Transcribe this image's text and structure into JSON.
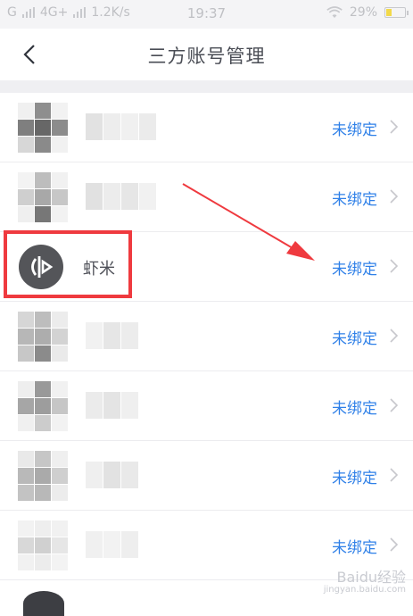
{
  "status_bar": {
    "signal_left": "G",
    "network": "4G+",
    "speed": "1.2K/s",
    "time": "19:37",
    "battery_percent": "29%",
    "battery_level": 0.29,
    "battery_color": "#f2d94a"
  },
  "header": {
    "title": "三方账号管理"
  },
  "rows": [
    {
      "name": "",
      "status": "未绑定"
    },
    {
      "name": "",
      "status": "未绑定"
    },
    {
      "name": "虾米",
      "status": "未绑定"
    },
    {
      "name": "",
      "status": "未绑定"
    },
    {
      "name": "",
      "status": "未绑定"
    },
    {
      "name": "",
      "status": "未绑定"
    },
    {
      "name": "",
      "status": "未绑定"
    }
  ],
  "colors": {
    "accent": "#2f80e8",
    "highlight": "#ef3a3f"
  },
  "watermark": {
    "text": "Baidu经验",
    "url": "jingyan.baidu.com"
  }
}
